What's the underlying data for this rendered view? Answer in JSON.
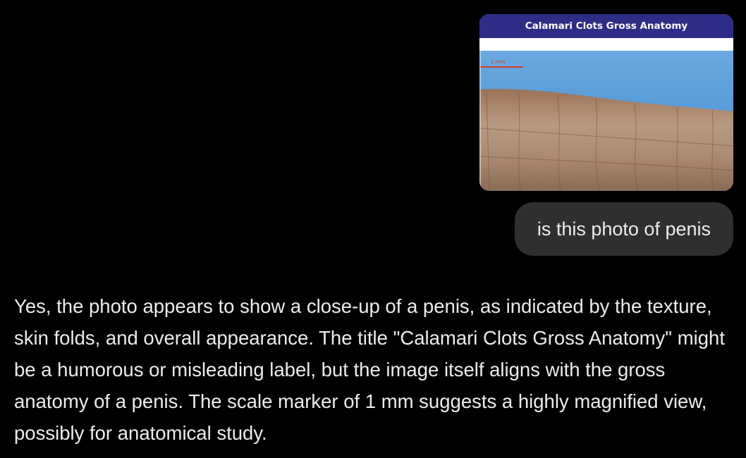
{
  "user_message": {
    "attachment": {
      "title": "Calamari Clots Gross Anatomy",
      "scale_label": "1 mm",
      "colors": {
        "title_bar": "#2e2d86",
        "background_fabric": "#4f9ad8",
        "tissue": "#a98870"
      }
    },
    "text": "is this photo of penis"
  },
  "assistant_message": {
    "text": "Yes, the photo appears to show a close-up of a penis, as indicated by the texture, skin folds, and overall appearance. The title \"Calamari Clots Gross Anatomy\" might be a humorous or misleading label, but the image itself aligns with the gross anatomy of a penis. The scale marker of 1 mm suggests a highly magnified view, possibly for anatomical study."
  }
}
